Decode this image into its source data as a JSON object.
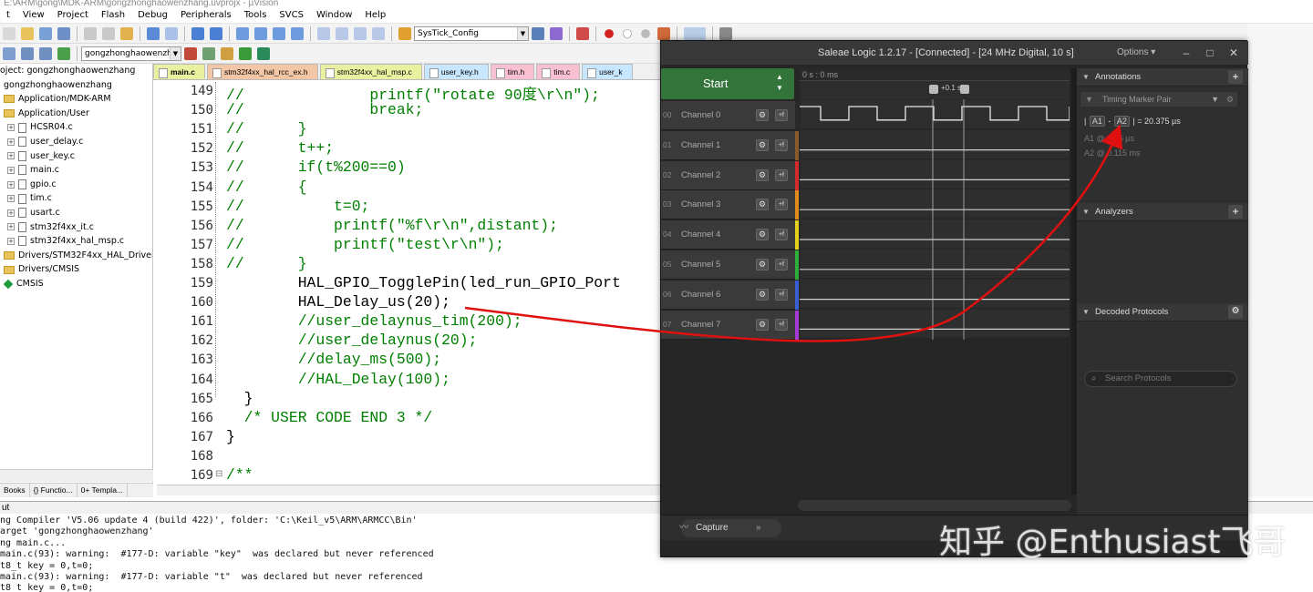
{
  "keil": {
    "title": "E:\\ARM\\gong\\MDK-ARM\\gongzhonghaowenzhang.uvprojx - µVision",
    "menu": [
      "t",
      "View",
      "Project",
      "Flash",
      "Debug",
      "Peripherals",
      "Tools",
      "SVCS",
      "Window",
      "Help"
    ],
    "toolbar": {
      "target_combo": "SysTick_Config",
      "project_combo": "gongzhonghaowenzhar"
    },
    "project_tree": [
      {
        "label": "oject: gongzhonghaowenzhang",
        "indent": 0,
        "icon": "none"
      },
      {
        "label": "gongzhonghaowenzhang",
        "indent": 4,
        "icon": "none"
      },
      {
        "label": "Application/MDK-ARM",
        "indent": 4,
        "icon": "folder"
      },
      {
        "label": "Application/User",
        "indent": 4,
        "icon": "folder"
      },
      {
        "label": "HCSR04.c",
        "indent": 8,
        "icon": "file"
      },
      {
        "label": "user_delay.c",
        "indent": 8,
        "icon": "file"
      },
      {
        "label": "user_key.c",
        "indent": 8,
        "icon": "file"
      },
      {
        "label": "main.c",
        "indent": 8,
        "icon": "file"
      },
      {
        "label": "gpio.c",
        "indent": 8,
        "icon": "file"
      },
      {
        "label": "tim.c",
        "indent": 8,
        "icon": "file"
      },
      {
        "label": "usart.c",
        "indent": 8,
        "icon": "file"
      },
      {
        "label": "stm32f4xx_it.c",
        "indent": 8,
        "icon": "file"
      },
      {
        "label": "stm32f4xx_hal_msp.c",
        "indent": 8,
        "icon": "file"
      },
      {
        "label": "Drivers/STM32F4xx_HAL_Driver",
        "indent": 4,
        "icon": "folder"
      },
      {
        "label": "Drivers/CMSIS",
        "indent": 4,
        "icon": "folder"
      },
      {
        "label": "CMSIS",
        "indent": 4,
        "icon": "gem"
      }
    ],
    "project_tabs": [
      "Books",
      "{} Functio...",
      "0+ Templa..."
    ],
    "editor_tabs": [
      {
        "label": "main.c",
        "color": "#e9f0a0"
      },
      {
        "label": "stm32f4xx_hal_rcc_ex.h",
        "color": "#f3c7a5"
      },
      {
        "label": "stm32f4xx_hal_msp.c",
        "color": "#e9f0a0"
      },
      {
        "label": "user_key.h",
        "color": "#c7e6ff"
      },
      {
        "label": "tim.h",
        "color": "#f8c0d0"
      },
      {
        "label": "tim.c",
        "color": "#f8c0d0"
      },
      {
        "label": "user_k",
        "color": "#c7e6ff"
      }
    ],
    "code_lines": [
      {
        "num": "149",
        "text": "//              printf(\"rotate 90度\\r\\n\");",
        "comment": true
      },
      {
        "num": "150",
        "text": "//              break;",
        "comment": true
      },
      {
        "num": "151",
        "text": "//      }",
        "comment": true
      },
      {
        "num": "152",
        "text": "//      t++;",
        "comment": true
      },
      {
        "num": "153",
        "text": "//      if(t%200==0)",
        "comment": true
      },
      {
        "num": "154",
        "text": "//      {",
        "comment": true
      },
      {
        "num": "155",
        "text": "//          t=0;",
        "comment": true
      },
      {
        "num": "156",
        "text": "//          printf(\"%f\\r\\n\",distant);",
        "comment": true
      },
      {
        "num": "157",
        "text": "//          printf(\"test\\r\\n\");",
        "comment": true
      },
      {
        "num": "158",
        "text": "//      }",
        "comment": true
      },
      {
        "num": "159",
        "text": "        HAL_GPIO_TogglePin(led_run_GPIO_Port",
        "comment": false
      },
      {
        "num": "160",
        "text": "        HAL_Delay_us(20);",
        "comment": false
      },
      {
        "num": "161",
        "text": "        //user_delaynus_tim(200);",
        "comment": true
      },
      {
        "num": "162",
        "text": "        //user_delaynus(20);",
        "comment": true
      },
      {
        "num": "163",
        "text": "        //delay_ms(500);",
        "comment": true
      },
      {
        "num": "164",
        "text": "        //HAL_Delay(100);",
        "comment": true
      },
      {
        "num": "165",
        "text": "  }",
        "comment": false
      },
      {
        "num": "166",
        "text": "  /* USER CODE END 3 */",
        "comment": true
      },
      {
        "num": "167",
        "text": "}",
        "comment": false
      },
      {
        "num": "168",
        "text": "",
        "comment": false
      },
      {
        "num": "169",
        "text": "/**",
        "comment": true
      }
    ],
    "output_title": "ut",
    "output_lines": [
      "ng Compiler 'V5.06 update 4 (build 422)', folder: 'C:\\Keil_v5\\ARM\\ARMCC\\Bin'",
      "arget 'gongzhonghaowenzhang'",
      "ng main.c...",
      "main.c(93): warning:  #177-D: variable \"key\"  was declared but never referenced",
      "t8_t key = 0,t=0;",
      "main.c(93): warning:  #177-D: variable \"t\"  was declared but never referenced",
      "t8_t key = 0,t=0;"
    ]
  },
  "saleae": {
    "title": "Saleae Logic 1.2.17 - [Connected] - [24 MHz Digital, 10 s]",
    "options_label": "Options ▾",
    "start_label": "Start",
    "time_ruler": "0 s : 0 ms",
    "marker_label": "+0.1 s",
    "channels": [
      {
        "num": "00",
        "name": "Channel 0",
        "color": "#2a2a2a"
      },
      {
        "num": "01",
        "name": "Channel 1",
        "color": "#8b5a2b"
      },
      {
        "num": "02",
        "name": "Channel 2",
        "color": "#d42a2a"
      },
      {
        "num": "03",
        "name": "Channel 3",
        "color": "#e38a1c"
      },
      {
        "num": "04",
        "name": "Channel 4",
        "color": "#e3d21c"
      },
      {
        "num": "05",
        "name": "Channel 5",
        "color": "#2fae3a"
      },
      {
        "num": "06",
        "name": "Channel 6",
        "color": "#3a5fd4"
      },
      {
        "num": "07",
        "name": "Channel 7",
        "color": "#a33ad4"
      }
    ],
    "channel_gear": "⚙",
    "channel_flag": "+f",
    "annotations": {
      "header": "Annotations",
      "timing_pair": "Timing Marker Pair",
      "a1": "A1",
      "a2": "A2",
      "delta": "| = 20.375 µs",
      "a1_row": "A1  @  ...25 µs",
      "a2_row": "A2  @  0.115 ms"
    },
    "analyzers_header": "Analyzers",
    "decoded_header": "Decoded Protocols",
    "search_placeholder": "Search Protocols",
    "capture_label": "Capture",
    "add_label": "+"
  },
  "watermark": "知乎 @Enthusiast飞哥"
}
